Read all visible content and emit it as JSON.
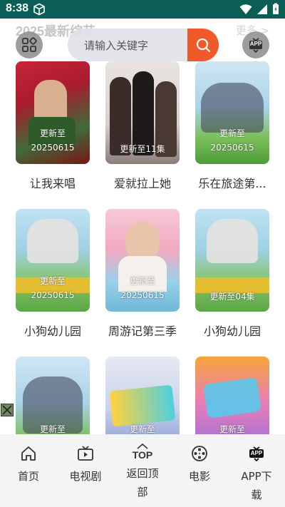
{
  "status_bar": {
    "time": "8:38"
  },
  "section": {
    "title": "2025最新综艺",
    "more": "更多 >"
  },
  "search": {
    "placeholder": "请输入关键字"
  },
  "app_badge": "APP",
  "cards": [
    {
      "title": "让我来唱",
      "update_line1": "更新至",
      "update_line2": "20250615"
    },
    {
      "title": "爱就拉上她",
      "update_line1": "",
      "update_line2": "更新至11集"
    },
    {
      "title": "乐在旅途第...",
      "update_line1": "更新至",
      "update_line2": "20250615"
    },
    {
      "title": "小狗幼儿园",
      "update_line1": "更新至",
      "update_line2": "20250615"
    },
    {
      "title": "周游记第三季",
      "update_line1": "更新至",
      "update_line2": "20250615"
    },
    {
      "title": "小狗幼儿园",
      "update_line1": "",
      "update_line2": "更新至04集"
    },
    {
      "title": "",
      "update_line1": "",
      "update_line2": "更新至"
    },
    {
      "title": "",
      "update_line1": "",
      "update_line2": "更新至"
    },
    {
      "title": "",
      "update_line1": "",
      "update_line2": "更新至"
    }
  ],
  "tabs": [
    {
      "label": "首页",
      "icon": "home-icon"
    },
    {
      "label": "电视剧",
      "icon": "tv-icon"
    },
    {
      "label": "返回顶部",
      "label_line1": "返回顶",
      "label_line2": "部",
      "icon_text": "TOP"
    },
    {
      "label": "电影",
      "icon": "film-reel-icon"
    },
    {
      "label": "APP下载",
      "label_line1": "APP下",
      "label_line2": "载",
      "icon_text": "APP"
    }
  ],
  "colors": {
    "status_bar": "#0b5e56",
    "search_button": "#f05a2a",
    "tabbar_bg": "#f4f4f4"
  }
}
